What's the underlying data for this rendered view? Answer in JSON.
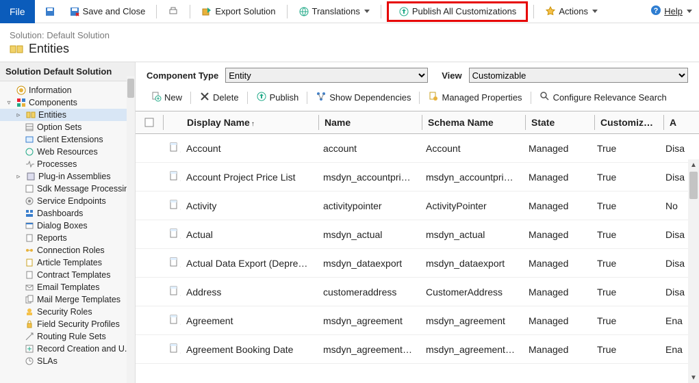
{
  "toolbar": {
    "file": "File",
    "save_close": "Save and Close",
    "export_solution": "Export Solution",
    "translations": "Translations",
    "publish_all": "Publish All Customizations",
    "actions": "Actions",
    "help": "Help"
  },
  "solution": {
    "header_grey": "Solution: Default Solution",
    "name": "Entities",
    "sidebar_header": "Solution Default Solution"
  },
  "tree": {
    "information": "Information",
    "components": "Components",
    "entities": "Entities",
    "option_sets": "Option Sets",
    "client_extensions": "Client Extensions",
    "web_resources": "Web Resources",
    "processes": "Processes",
    "plugin_assemblies": "Plug-in Assemblies",
    "sdk_msg": "Sdk Message Processing...",
    "service_endpoints": "Service Endpoints",
    "dashboards": "Dashboards",
    "dialog_boxes": "Dialog Boxes",
    "reports": "Reports",
    "connection_roles": "Connection Roles",
    "article_templates": "Article Templates",
    "contract_templates": "Contract Templates",
    "email_templates": "Email Templates",
    "mail_merge": "Mail Merge Templates",
    "security_roles": "Security Roles",
    "field_security": "Field Security Profiles",
    "routing_rule": "Routing Rule Sets",
    "record_creation": "Record Creation and U...",
    "slas": "SLAs"
  },
  "filters": {
    "component_type_label": "Component Type",
    "component_type_value": "Entity",
    "view_label": "View",
    "view_value": "Customizable"
  },
  "toolbar2": {
    "new": "New",
    "delete": "Delete",
    "publish": "Publish",
    "show_deps": "Show Dependencies",
    "managed_props": "Managed Properties",
    "configure_relevance": "Configure Relevance Search"
  },
  "columns": {
    "display_name": "Display Name",
    "name": "Name",
    "schema_name": "Schema Name",
    "state": "State",
    "customizable": "Customizabl...",
    "action": "A"
  },
  "rows": [
    {
      "dn": "Account",
      "nm": "account",
      "sn": "Account",
      "st": "Managed",
      "cu": "True",
      "ac": "Disa"
    },
    {
      "dn": "Account Project Price List",
      "nm": "msdyn_accountprice...",
      "sn": "msdyn_accountprice...",
      "st": "Managed",
      "cu": "True",
      "ac": "Disa"
    },
    {
      "dn": "Activity",
      "nm": "activitypointer",
      "sn": "ActivityPointer",
      "st": "Managed",
      "cu": "True",
      "ac": "No"
    },
    {
      "dn": "Actual",
      "nm": "msdyn_actual",
      "sn": "msdyn_actual",
      "st": "Managed",
      "cu": "True",
      "ac": "Disa"
    },
    {
      "dn": "Actual Data Export (Deprecat...",
      "nm": "msdyn_dataexport",
      "sn": "msdyn_dataexport",
      "st": "Managed",
      "cu": "True",
      "ac": "Disa"
    },
    {
      "dn": "Address",
      "nm": "customeraddress",
      "sn": "CustomerAddress",
      "st": "Managed",
      "cu": "True",
      "ac": "Disa"
    },
    {
      "dn": "Agreement",
      "nm": "msdyn_agreement",
      "sn": "msdyn_agreement",
      "st": "Managed",
      "cu": "True",
      "ac": "Ena"
    },
    {
      "dn": "Agreement Booking Date",
      "nm": "msdyn_agreementb...",
      "sn": "msdyn_agreementb...",
      "st": "Managed",
      "cu": "True",
      "ac": "Ena"
    }
  ]
}
